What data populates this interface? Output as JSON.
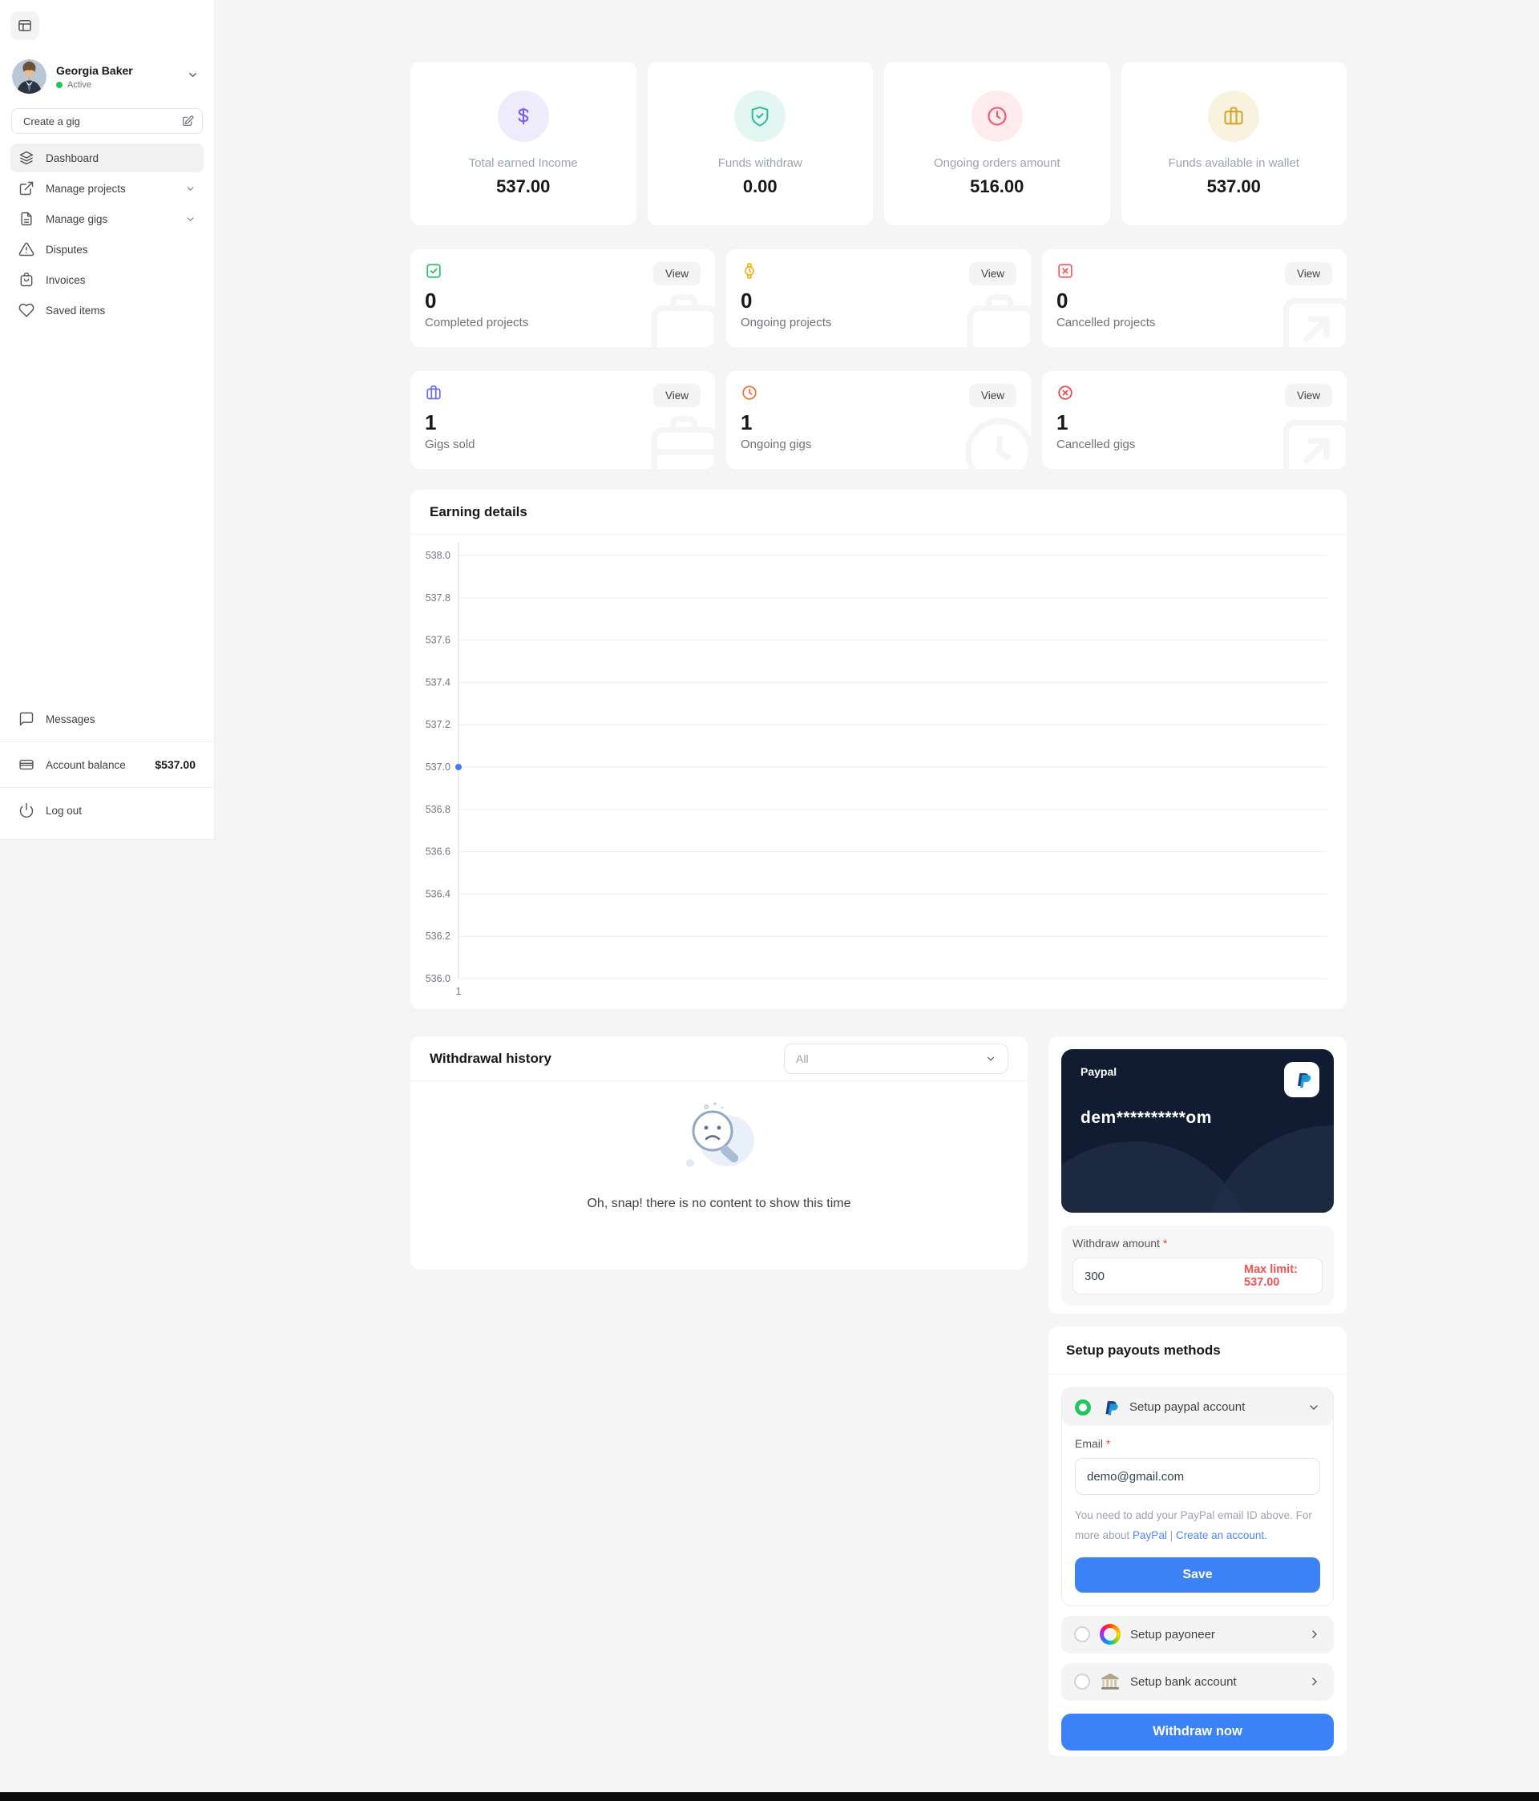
{
  "sidebar": {
    "profile": {
      "name": "Georgia Baker",
      "status": "Active"
    },
    "create_gig_label": "Create a gig",
    "nav": [
      {
        "label": "Dashboard"
      },
      {
        "label": "Manage projects"
      },
      {
        "label": "Manage gigs"
      },
      {
        "label": "Disputes"
      },
      {
        "label": "Invoices"
      },
      {
        "label": "Saved items"
      }
    ],
    "messages_label": "Messages",
    "account_balance_label": "Account balance",
    "account_balance_value": "$537.00",
    "logout_label": "Log out"
  },
  "stats": [
    {
      "label": "Total earned Income",
      "value": "537.00",
      "icon": "dollar-icon",
      "fg": "#7c5cfa",
      "bg": "#eeebfd"
    },
    {
      "label": "Funds withdraw",
      "value": "0.00",
      "icon": "shield-check-icon",
      "fg": "#2fbfa0",
      "bg": "#e4f6f1"
    },
    {
      "label": "Ongoing orders amount",
      "value": "516.00",
      "icon": "clock-icon",
      "fg": "#f4536e",
      "bg": "#fdebee"
    },
    {
      "label": "Funds available in wallet",
      "value": "537.00",
      "icon": "briefcase-icon",
      "fg": "#d9a42b",
      "bg": "#f9f2df"
    }
  ],
  "project_cards": [
    {
      "label": "Completed projects",
      "value": "0",
      "view": "View",
      "icon": "square-check-icon",
      "color": "#27c06d"
    },
    {
      "label": "Ongoing projects",
      "value": "0",
      "view": "View",
      "icon": "watch-icon",
      "color": "#f2b713"
    },
    {
      "label": "Cancelled projects",
      "value": "0",
      "view": "View",
      "icon": "square-x-icon",
      "color": "#f15b5b"
    },
    {
      "label": "Gigs sold",
      "value": "1",
      "view": "View",
      "icon": "briefcase-icon",
      "color": "#6a6af4"
    },
    {
      "label": "Ongoing gigs",
      "value": "1",
      "view": "View",
      "icon": "clock-icon",
      "color": "#f4702a"
    },
    {
      "label": "Cancelled gigs",
      "value": "1",
      "view": "View",
      "icon": "circle-x-icon",
      "color": "#ee4444"
    }
  ],
  "earning": {
    "title": "Earning details"
  },
  "chart_data": {
    "type": "line",
    "title": "Earning details",
    "x": [
      1
    ],
    "xticks": [
      "1"
    ],
    "series": [
      {
        "name": "Earnings",
        "values": [
          537.0
        ]
      }
    ],
    "ylim": [
      536.0,
      538.0
    ],
    "yticks": [
      "538.0",
      "537.8",
      "537.6",
      "537.4",
      "537.2",
      "537.0",
      "536.8",
      "536.6",
      "536.4",
      "536.2",
      "536.0"
    ],
    "grid": true,
    "legend": false,
    "point_color": "#3f7ef8"
  },
  "withdrawal": {
    "title": "Withdrawal history",
    "filter_value": "All",
    "empty_text": "Oh, snap! there is no content to show this time"
  },
  "paypal_card": {
    "brand": "Paypal",
    "masked_email": "dem**********om"
  },
  "withdraw_form": {
    "label": "Withdraw amount",
    "required_mark": "*",
    "value": "300",
    "max_limit": "Max limit: 537.00"
  },
  "payouts": {
    "title": "Setup payouts methods",
    "paypal_option": "Setup paypal account",
    "email_label": "Email",
    "email_required_mark": "*",
    "email_value": "demo@gmail.com",
    "note_before": "You need to add your PayPal email ID above. For more about ",
    "note_link1": "PayPal",
    "note_sep": " | ",
    "note_link2": "Create an account.",
    "save_label": "Save",
    "payoneer_option": "Setup payoneer",
    "bank_option": "Setup bank account",
    "withdraw_button": "Withdraw now"
  },
  "colors": {
    "accent_blue": "#3b82f6",
    "danger": "#ef4444",
    "success": "#22c55e",
    "paypal_panel": "#111c33"
  }
}
